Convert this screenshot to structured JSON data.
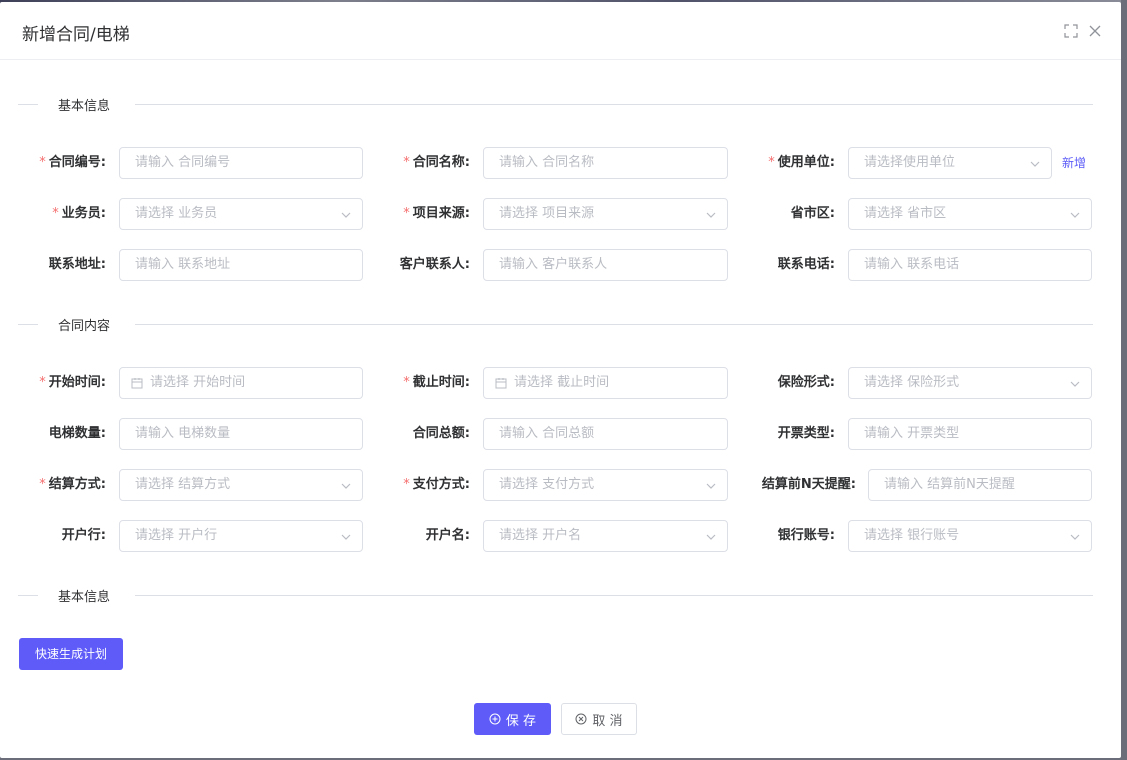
{
  "dialog": {
    "title": "新增合同/电梯",
    "icons": {
      "maximize": "fullscreen-icon",
      "close": "close-icon"
    }
  },
  "sections": {
    "basic": "基本信息",
    "content": "合同内容",
    "basic2": "基本信息"
  },
  "fields": {
    "contract_no": {
      "label": "合同编号:",
      "placeholder": "请输入 合同编号",
      "required": true
    },
    "contract_name": {
      "label": "合同名称:",
      "placeholder": "请输入 合同名称",
      "required": true
    },
    "use_unit": {
      "label": "使用单位:",
      "placeholder": "请选择使用单位",
      "required": true
    },
    "salesman": {
      "label": "业务员:",
      "placeholder": "请选择 业务员",
      "required": true
    },
    "project_source": {
      "label": "项目来源:",
      "placeholder": "请选择 项目来源",
      "required": true
    },
    "region": {
      "label": "省市区:",
      "placeholder": "请选择 省市区",
      "required": false
    },
    "address": {
      "label": "联系地址:",
      "placeholder": "请输入 联系地址",
      "required": false
    },
    "contact": {
      "label": "客户联系人:",
      "placeholder": "请输入 客户联系人",
      "required": false
    },
    "phone": {
      "label": "联系电话:",
      "placeholder": "请输入 联系电话",
      "required": false
    },
    "start_time": {
      "label": "开始时间:",
      "placeholder": "请选择 开始时间",
      "required": true
    },
    "end_time": {
      "label": "截止时间:",
      "placeholder": "请选择 截止时间",
      "required": true
    },
    "insurance": {
      "label": "保险形式:",
      "placeholder": "请选择 保险形式",
      "required": false
    },
    "elevator_count": {
      "label": "电梯数量:",
      "placeholder": "请输入 电梯数量",
      "required": false
    },
    "total_amount": {
      "label": "合同总额:",
      "placeholder": "请输入 合同总额",
      "required": false
    },
    "invoice_type": {
      "label": "开票类型:",
      "placeholder": "请输入 开票类型",
      "required": false
    },
    "settle_method": {
      "label": "结算方式:",
      "placeholder": "请选择 结算方式",
      "required": true
    },
    "pay_method": {
      "label": "支付方式:",
      "placeholder": "请选择 支付方式",
      "required": true
    },
    "remind_days": {
      "label": "结算前N天提醒:",
      "placeholder": "请输入 结算前N天提醒",
      "required": false
    },
    "bank": {
      "label": "开户行:",
      "placeholder": "请选择 开户行",
      "required": false
    },
    "account_name": {
      "label": "开户名:",
      "placeholder": "请选择 开户名",
      "required": false
    },
    "account_no": {
      "label": "银行账号:",
      "placeholder": "请选择 银行账号",
      "required": false
    }
  },
  "links": {
    "add_unit": "新增"
  },
  "buttons": {
    "quick_plan": "快速生成计划",
    "save": "保 存",
    "cancel": "取 消"
  },
  "colors": {
    "primary": "#5e5bf8",
    "required": "#f56c6c",
    "placeholder": "#b9bcc3",
    "border": "#dcdfe6"
  }
}
